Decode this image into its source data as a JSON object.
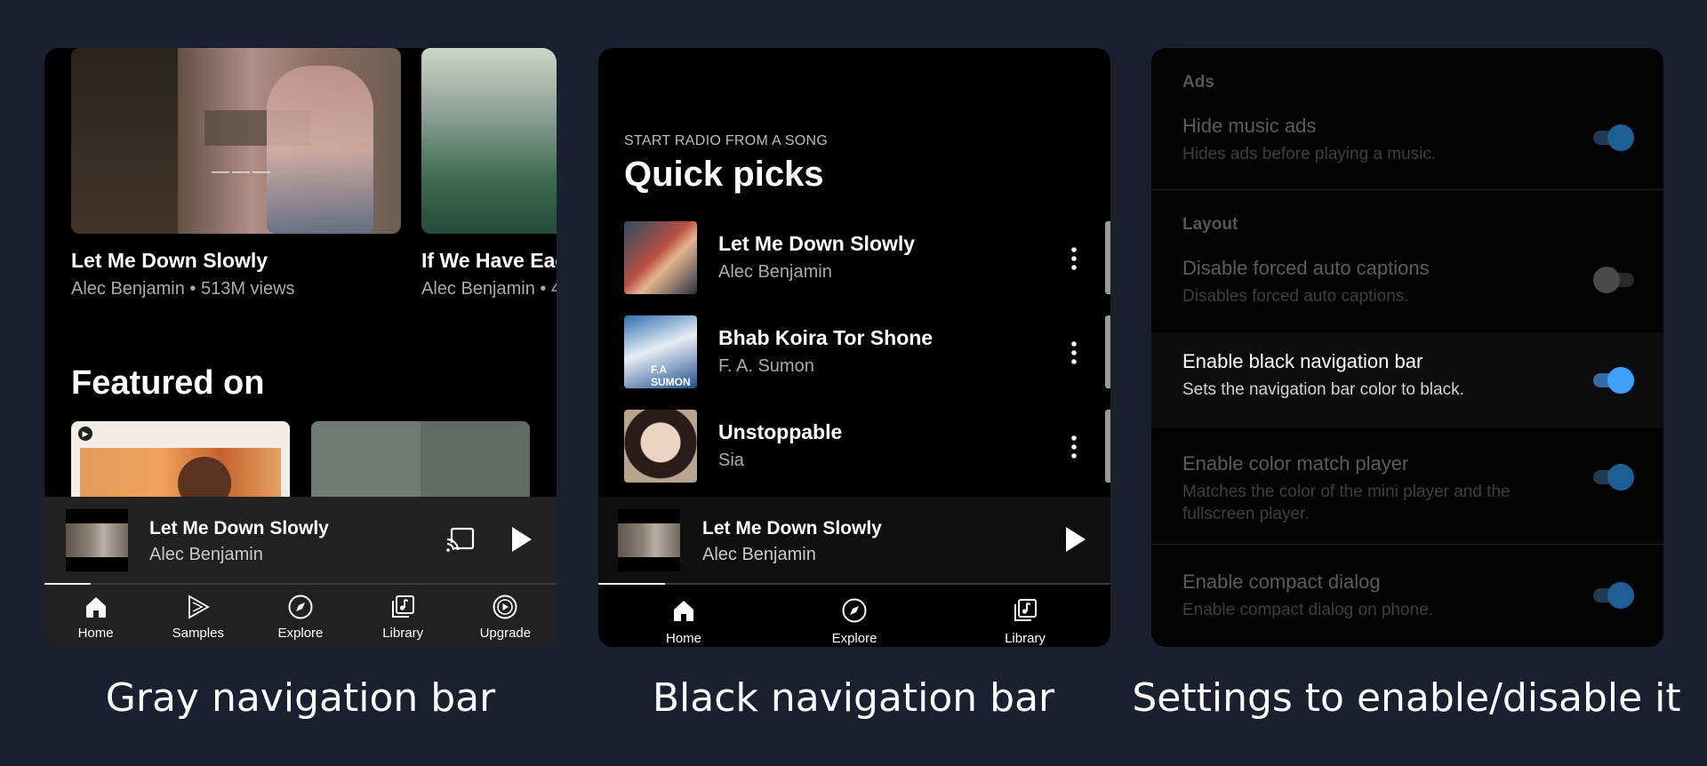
{
  "captions": {
    "gray": "Gray navigation bar",
    "black": "Black navigation bar",
    "settings": "Settings to enable/disable it"
  },
  "gray_panel": {
    "videos": [
      {
        "title": "Let Me Down Slowly",
        "subtitle": "Alec Benjamin • 513M views"
      },
      {
        "title": "If We Have Eac",
        "subtitle": "Alec Benjamin • 4"
      }
    ],
    "thumb_overlay": "———",
    "featured_heading": "Featured on",
    "mini_player": {
      "title": "Let Me Down Slowly",
      "artist": "Alec Benjamin",
      "icons": [
        "cast-icon",
        "play-icon"
      ],
      "progress": 0.09
    },
    "nav": [
      {
        "label": "Home",
        "icon": "home-icon"
      },
      {
        "label": "Samples",
        "icon": "samples-icon"
      },
      {
        "label": "Explore",
        "icon": "explore-icon"
      },
      {
        "label": "Library",
        "icon": "library-icon"
      },
      {
        "label": "Upgrade",
        "icon": "upgrade-icon"
      }
    ],
    "nav_color": "#212121"
  },
  "black_panel": {
    "eyebrow": "START RADIO FROM A SONG",
    "heading": "Quick picks",
    "songs": [
      {
        "title": "Let Me Down Slowly",
        "artist": "Alec Benjamin"
      },
      {
        "title": "Bhab Koira Tor Shone",
        "artist": "F. A. Sumon",
        "art_text": "F.A SUMON"
      },
      {
        "title": "Unstoppable",
        "artist": "Sia"
      }
    ],
    "mini_player": {
      "title": "Let Me Down Slowly",
      "artist": "Alec Benjamin",
      "progress": 0.13
    },
    "nav": [
      {
        "label": "Home",
        "icon": "home-icon"
      },
      {
        "label": "Explore",
        "icon": "explore-icon"
      },
      {
        "label": "Library",
        "icon": "library-icon"
      }
    ],
    "nav_color": "#000000"
  },
  "settings_panel": {
    "sections": {
      "ads": "Ads",
      "layout": "Layout"
    },
    "items": [
      {
        "title": "Hide music ads",
        "subtitle": "Hides ads before playing a music.",
        "enabled": true
      },
      {
        "title": "Disable forced auto captions",
        "subtitle": "Disables forced auto captions.",
        "enabled": false
      },
      {
        "title": "Enable black navigation bar",
        "subtitle": "Sets the navigation bar color to black.",
        "enabled": true,
        "highlighted": true
      },
      {
        "title": "Enable color match player",
        "subtitle": "Matches the color of the mini player and the fullscreen player.",
        "enabled": true
      },
      {
        "title": "Enable compact dialog",
        "subtitle": "Enable compact dialog on phone.",
        "enabled": true
      }
    ],
    "accent": "#3fa1ff"
  }
}
